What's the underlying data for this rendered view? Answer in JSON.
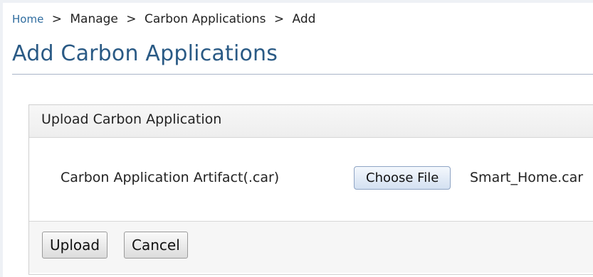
{
  "breadcrumb": {
    "home": "Home",
    "separator": ">",
    "items": [
      "Manage",
      "Carbon Applications",
      "Add"
    ]
  },
  "page": {
    "title": "Add Carbon Applications"
  },
  "panel": {
    "header": "Upload Carbon Application",
    "artifact_label": "Carbon Application Artifact(.car)",
    "choose_file_label": "Choose File",
    "selected_file": "Smart_Home.car"
  },
  "actions": {
    "upload_label": "Upload",
    "cancel_label": "Cancel"
  },
  "colors": {
    "link": "#2f6c9f",
    "title": "#2a5a85",
    "rule": "#a9b5c8"
  }
}
